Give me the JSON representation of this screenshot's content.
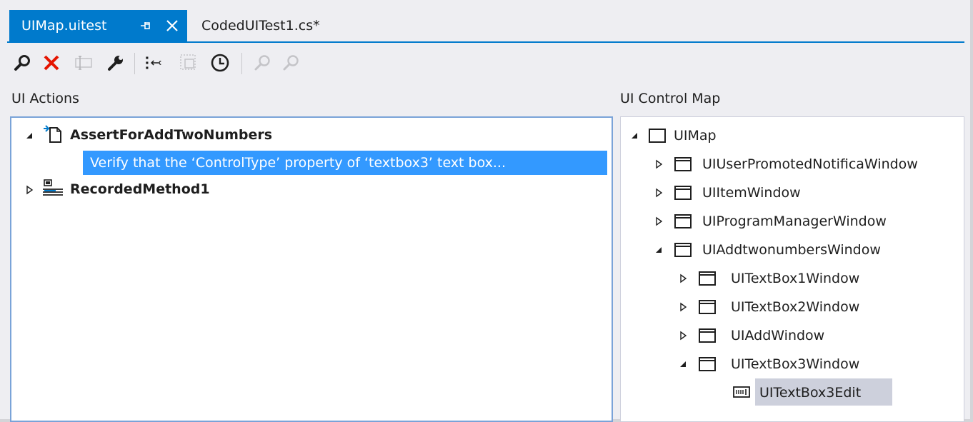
{
  "tabs": [
    {
      "label": "UIMap.uitest",
      "active": true
    },
    {
      "label": "CodedUITest1.cs*",
      "active": false
    }
  ],
  "toolbar": {
    "buttons": [
      "find-icon",
      "delete-icon",
      "rename-icon",
      "properties-icon",
      "move-code-icon",
      "split-icon",
      "delay-icon",
      "search-icon",
      "search-next-icon"
    ]
  },
  "ui_actions": {
    "title": "UI Actions",
    "items": [
      {
        "label": "AssertForAddTwoNumbers",
        "expanded": true,
        "children": [
          {
            "label": "Verify that the ‘ControlType’ property of ‘textbox3’ text box...",
            "selected": true
          }
        ]
      },
      {
        "label": "RecordedMethod1",
        "expanded": false
      }
    ]
  },
  "ui_control_map": {
    "title": "UI Control Map",
    "root": {
      "label": "UIMap",
      "children": [
        {
          "label": "UIUserPromotedNotificaWindow",
          "expanded": false
        },
        {
          "label": "UIItemWindow",
          "expanded": false
        },
        {
          "label": "UIProgramManagerWindow",
          "expanded": false
        },
        {
          "label": "UIAddtwonumbersWindow",
          "expanded": true,
          "children": [
            {
              "label": "UITextBox1Window",
              "expanded": false
            },
            {
              "label": "UITextBox2Window",
              "expanded": false
            },
            {
              "label": "UIAddWindow",
              "expanded": false
            },
            {
              "label": "UITextBox3Window",
              "expanded": true,
              "children": [
                {
                  "label": "UITextBox3Edit",
                  "selected": true
                }
              ]
            }
          ]
        }
      ]
    }
  },
  "colors": {
    "accent": "#007acc",
    "selection": "#3399ff",
    "selection_inactive": "#cdd0dc",
    "delete": "#e51400"
  }
}
